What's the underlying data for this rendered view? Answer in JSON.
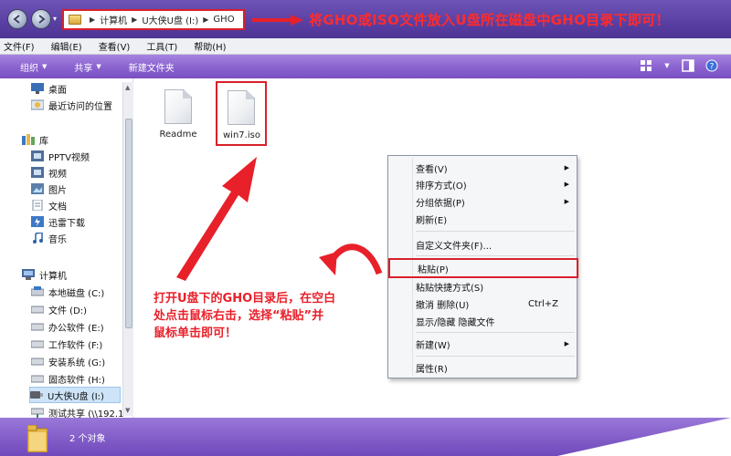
{
  "address_bar": {
    "crumbs": [
      "计算机",
      "U大侠U盘 (I:)",
      "GHO"
    ]
  },
  "title_annotation": "将GHO或ISO文件放入U盘所在磁盘中GHO目录下即可！",
  "menubar": [
    "文件(F)",
    "编辑(E)",
    "查看(V)",
    "工具(T)",
    "帮助(H)"
  ],
  "toolbar": {
    "organize": "组织",
    "share": "共享",
    "new_folder": "新建文件夹"
  },
  "navpane": {
    "items": [
      {
        "label": "桌面",
        "icon": "desktop-icon"
      },
      {
        "label": "最近访问的位置",
        "icon": "recent-places-icon"
      },
      {
        "label": "库",
        "icon": "library-icon"
      },
      {
        "label": "PPTV视频",
        "icon": "pptv-video-icon"
      },
      {
        "label": "视频",
        "icon": "video-icon"
      },
      {
        "label": "图片",
        "icon": "pictures-icon"
      },
      {
        "label": "文档",
        "icon": "documents-icon"
      },
      {
        "label": "迅雷下载",
        "icon": "thunder-download-icon"
      },
      {
        "label": "音乐",
        "icon": "music-icon"
      },
      {
        "label": "计算机",
        "icon": "computer-icon"
      },
      {
        "label": "本地磁盘 (C:)",
        "icon": "drive-icon"
      },
      {
        "label": "文件 (D:)",
        "icon": "drive-icon"
      },
      {
        "label": "办公软件 (E:)",
        "icon": "drive-icon"
      },
      {
        "label": "工作软件 (F:)",
        "icon": "drive-icon"
      },
      {
        "label": "安装系统 (G:)",
        "icon": "drive-icon"
      },
      {
        "label": "固态软件 (H:)",
        "icon": "drive-icon"
      },
      {
        "label": "U大侠U盘 (I:)",
        "icon": "usb-drive-icon"
      },
      {
        "label": "测试共享 (\\\\192.1",
        "icon": "network-drive-icon"
      }
    ]
  },
  "files": [
    {
      "name": "Readme",
      "icon": "document-icon"
    },
    {
      "name": "win7.iso",
      "icon": "document-icon"
    }
  ],
  "context_menu": {
    "items": [
      {
        "label": "查看(V)",
        "submenu": true
      },
      {
        "label": "排序方式(O)",
        "submenu": true
      },
      {
        "label": "分组依据(P)",
        "submenu": true
      },
      {
        "label": "刷新(E)",
        "submenu": false
      },
      {
        "label": "自定义文件夹(F)...",
        "submenu": false
      },
      {
        "label": "粘贴(P)",
        "submenu": false
      },
      {
        "label": "粘贴快捷方式(S)",
        "submenu": false
      },
      {
        "label": "撤消 删除(U)",
        "submenu": false,
        "shortcut": "Ctrl+Z"
      },
      {
        "label": "显示/隐藏 隐藏文件",
        "submenu": false
      },
      {
        "label": "新建(W)",
        "submenu": true
      },
      {
        "label": "属性(R)",
        "submenu": false
      }
    ]
  },
  "annotation": {
    "lines": [
      "打开U盘下的GHO目录后，在空白",
      "处点击鼠标右击，选择“粘贴”并",
      "鼠标单击即可！"
    ]
  },
  "statusbar": {
    "text": "2 个对象"
  },
  "colors": {
    "title_bg": "#5a3fa3",
    "toolbar_bg": "#8a62cf",
    "annotation_red": "#e8202a",
    "highlight_border": "#d9202a"
  }
}
